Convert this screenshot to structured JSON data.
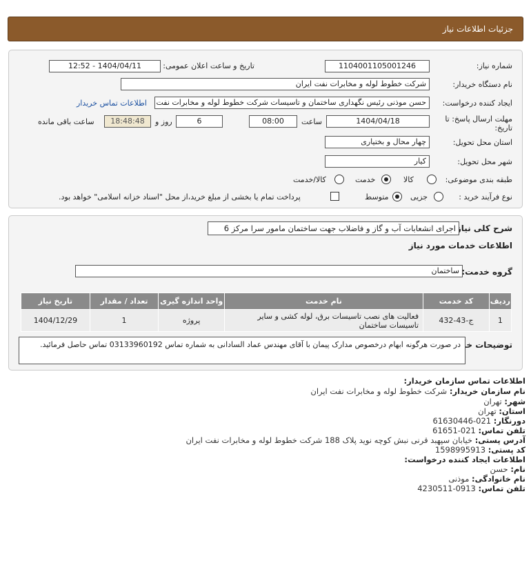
{
  "header": {
    "title": "جزئیات اطلاعات نیاز"
  },
  "form": {
    "need_number_label": "شماره نیاز:",
    "need_number": "1104001105001246",
    "announce_label": "تاریخ و ساعت اعلان عمومی:",
    "announce_value": "1404/04/11 - 12:52",
    "buyer_org_label": "نام دستگاه خریدار:",
    "buyer_org": "شرکت خطوط لوله و مخابرات نفت ایران",
    "creator_label": "ایجاد کننده درخواست:",
    "creator": "حسن  موذنی  رئیس نگهداری ساختمان و تاسیسات  شرکت خطوط لوله و مخابرات نفت ایران",
    "contact_link": "اطلاعات تماس خریدار",
    "deadline_label_1": "مهلت ارسال پاسخ: تا",
    "deadline_label_2": "تاریخ:",
    "deadline_date": "1404/04/18",
    "time_label": "ساعت",
    "deadline_time": "08:00",
    "days_value": "6",
    "days_label": "روز و",
    "remaining_time": "18:48:48",
    "remaining_label": "ساعت باقی مانده",
    "province_label": "استان محل تحویل:",
    "province": "چهار محال و بختیاری",
    "city_label": "شهر محل تحویل:",
    "city": "کیار",
    "category_label": "طبقه بندی موضوعی:",
    "category_options": [
      "کالا",
      "خدمت",
      "کالا/خدمت"
    ],
    "category_selected": "خدمت",
    "process_label": "نوع فرآیند خرید :",
    "process_options": [
      "جزیی",
      "متوسط"
    ],
    "process_selected": "متوسط",
    "payment_note": "پرداخت تمام یا بخشی از مبلغ خرید،از محل \"اسناد خزانه اسلامی\" خواهد بود."
  },
  "need": {
    "desc_label": "شرح کلی نیاز:",
    "desc": "اجرای انشعابات آب و گاز و فاضلاب جهت ساختمان مامور سرا مرکز 6",
    "services_title": "اطلاعات خدمات مورد نیاز",
    "group_label": "گروه خدمت:",
    "group": "ساختمان",
    "table_headers": [
      "ردیف",
      "کد خدمت",
      "نام خدمت",
      "واحد اندازه گیری",
      "تعداد / مقدار",
      "تاریخ نیاز"
    ],
    "rows": [
      {
        "row": "1",
        "code": "ج-43-432",
        "name": "فعالیت های نصب تاسیسات برق، لوله کشی و سایر تاسیسات ساختمان",
        "unit": "پروژه",
        "qty": "1",
        "date": "1404/12/29"
      }
    ],
    "buyer_notes_label": "توضیحات خریدار:",
    "buyer_notes": "در صورت هرگونه ابهام درخصوص مدارک پیمان با آقای مهندس عماد السادانی به شماره تماس 03133960192 تماس حاصل فرمائید."
  },
  "contact": {
    "org_title": "اطلاعات تماس سازمان خریدار:",
    "org_name_label": "نام سازمان خریدار:",
    "org_name": "شرکت خطوط لوله و مخابرات نفت ایران",
    "city_label": "شهر:",
    "city": "تهران",
    "province_label": "استان:",
    "province": "تهران",
    "fax_label": "دورنگار:",
    "fax": "021-61630446",
    "phone_label": "تلفن تماس:",
    "phone": "021-61651",
    "address_label": "آدرس پستی:",
    "address": "خیابان سپهبد قرنی نبش کوچه نوید پلاک 188 شرکت خطوط لوله و مخابرات نفت ایران",
    "postal_label": "کد پستی:",
    "postal": "1598995913",
    "creator_title": "اطلاعات ایجاد کننده درخواست:",
    "first_name_label": "نام:",
    "first_name": "حسن",
    "last_name_label": "نام خانوادگی:",
    "last_name": "موذنی",
    "creator_phone_label": "تلفن تماس:",
    "creator_phone": "0913-4230511"
  }
}
